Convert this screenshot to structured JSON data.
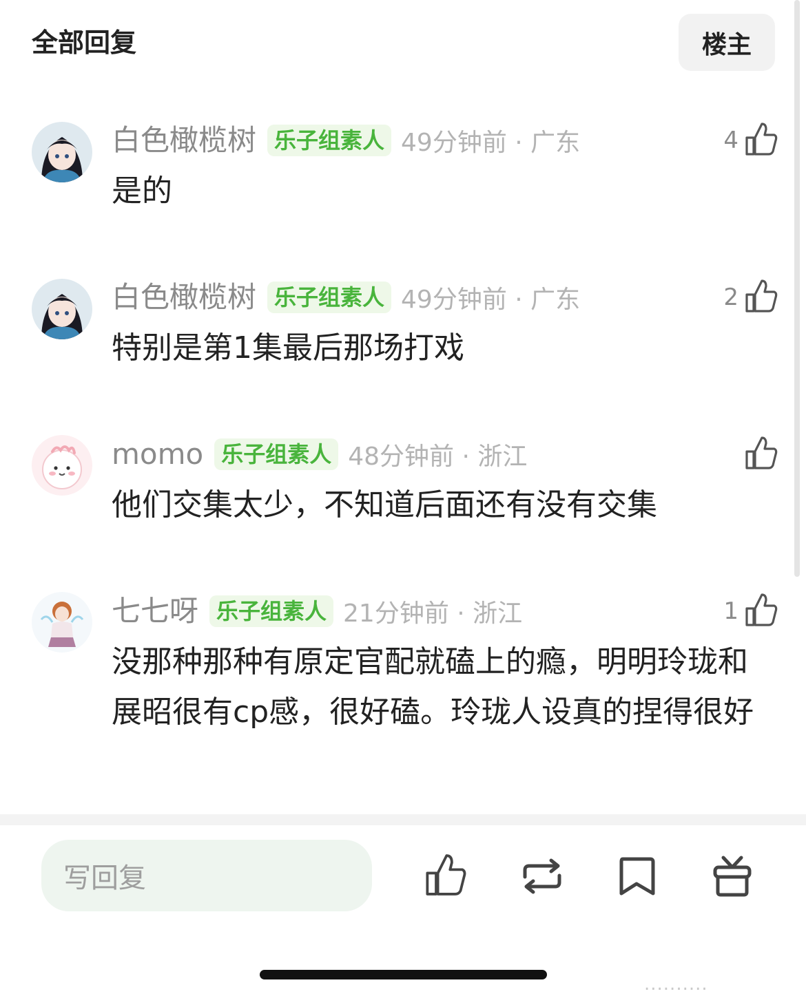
{
  "header": {
    "title": "全部回复",
    "op_button": "楼主"
  },
  "comments": [
    {
      "username": "白色橄榄树",
      "badge": "乐子组素人",
      "time": "49分钟前 · 广东",
      "likes": "4",
      "text": "是的"
    },
    {
      "username": "白色橄榄树",
      "badge": "乐子组素人",
      "time": "49分钟前 · 广东",
      "likes": "2",
      "text": "特别是第1集最后那场打戏"
    },
    {
      "username": "momo",
      "badge": "乐子组素人",
      "time": "48分钟前 · 浙江",
      "likes": "",
      "text": "他们交集太少，不知道后面还有没有交集"
    },
    {
      "username": "七七呀",
      "badge": "乐子组素人",
      "time": "21分钟前 · 浙江",
      "likes": "1",
      "text": "没那种那种有原定官配就磕上的瘾，明明玲珑和展昭很有cp感，很好磕。玲珑人设真的捏得很好"
    }
  ],
  "bottom_bar": {
    "reply_placeholder": "写回复"
  },
  "watermark": "..........",
  "colors": {
    "badge_text": "#49b43c",
    "badge_bg": "#eef8e8",
    "meta_text": "#8a8a8a",
    "input_bg": "#eef5ef"
  },
  "icons": [
    "thumbs-up-icon",
    "repost-icon",
    "bookmark-icon",
    "gift-icon"
  ]
}
